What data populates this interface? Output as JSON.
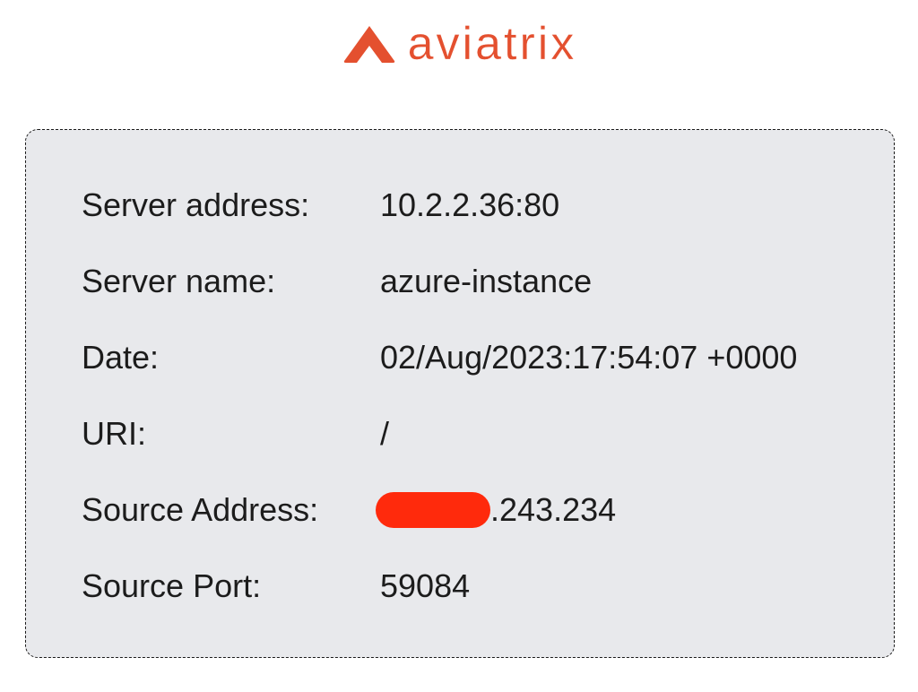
{
  "brand": {
    "name": "aviatrix",
    "color": "#e4502f",
    "icon": "aviatrix-logo-icon"
  },
  "info": {
    "rows": [
      {
        "label": "Server address:",
        "value": "10.2.2.36:80"
      },
      {
        "label": "Server name:",
        "value": "azure-instance"
      },
      {
        "label": "Date:",
        "value": "02/Aug/2023:17:54:07 +0000"
      },
      {
        "label": "URI:",
        "value": "/"
      },
      {
        "label": "Source Address:",
        "value": ".243.234",
        "redacted_prefix": true
      },
      {
        "label": "Source Port:",
        "value": "59084"
      }
    ]
  },
  "colors": {
    "card_background": "#e8e9ec",
    "redaction": "#ff2a0c"
  }
}
